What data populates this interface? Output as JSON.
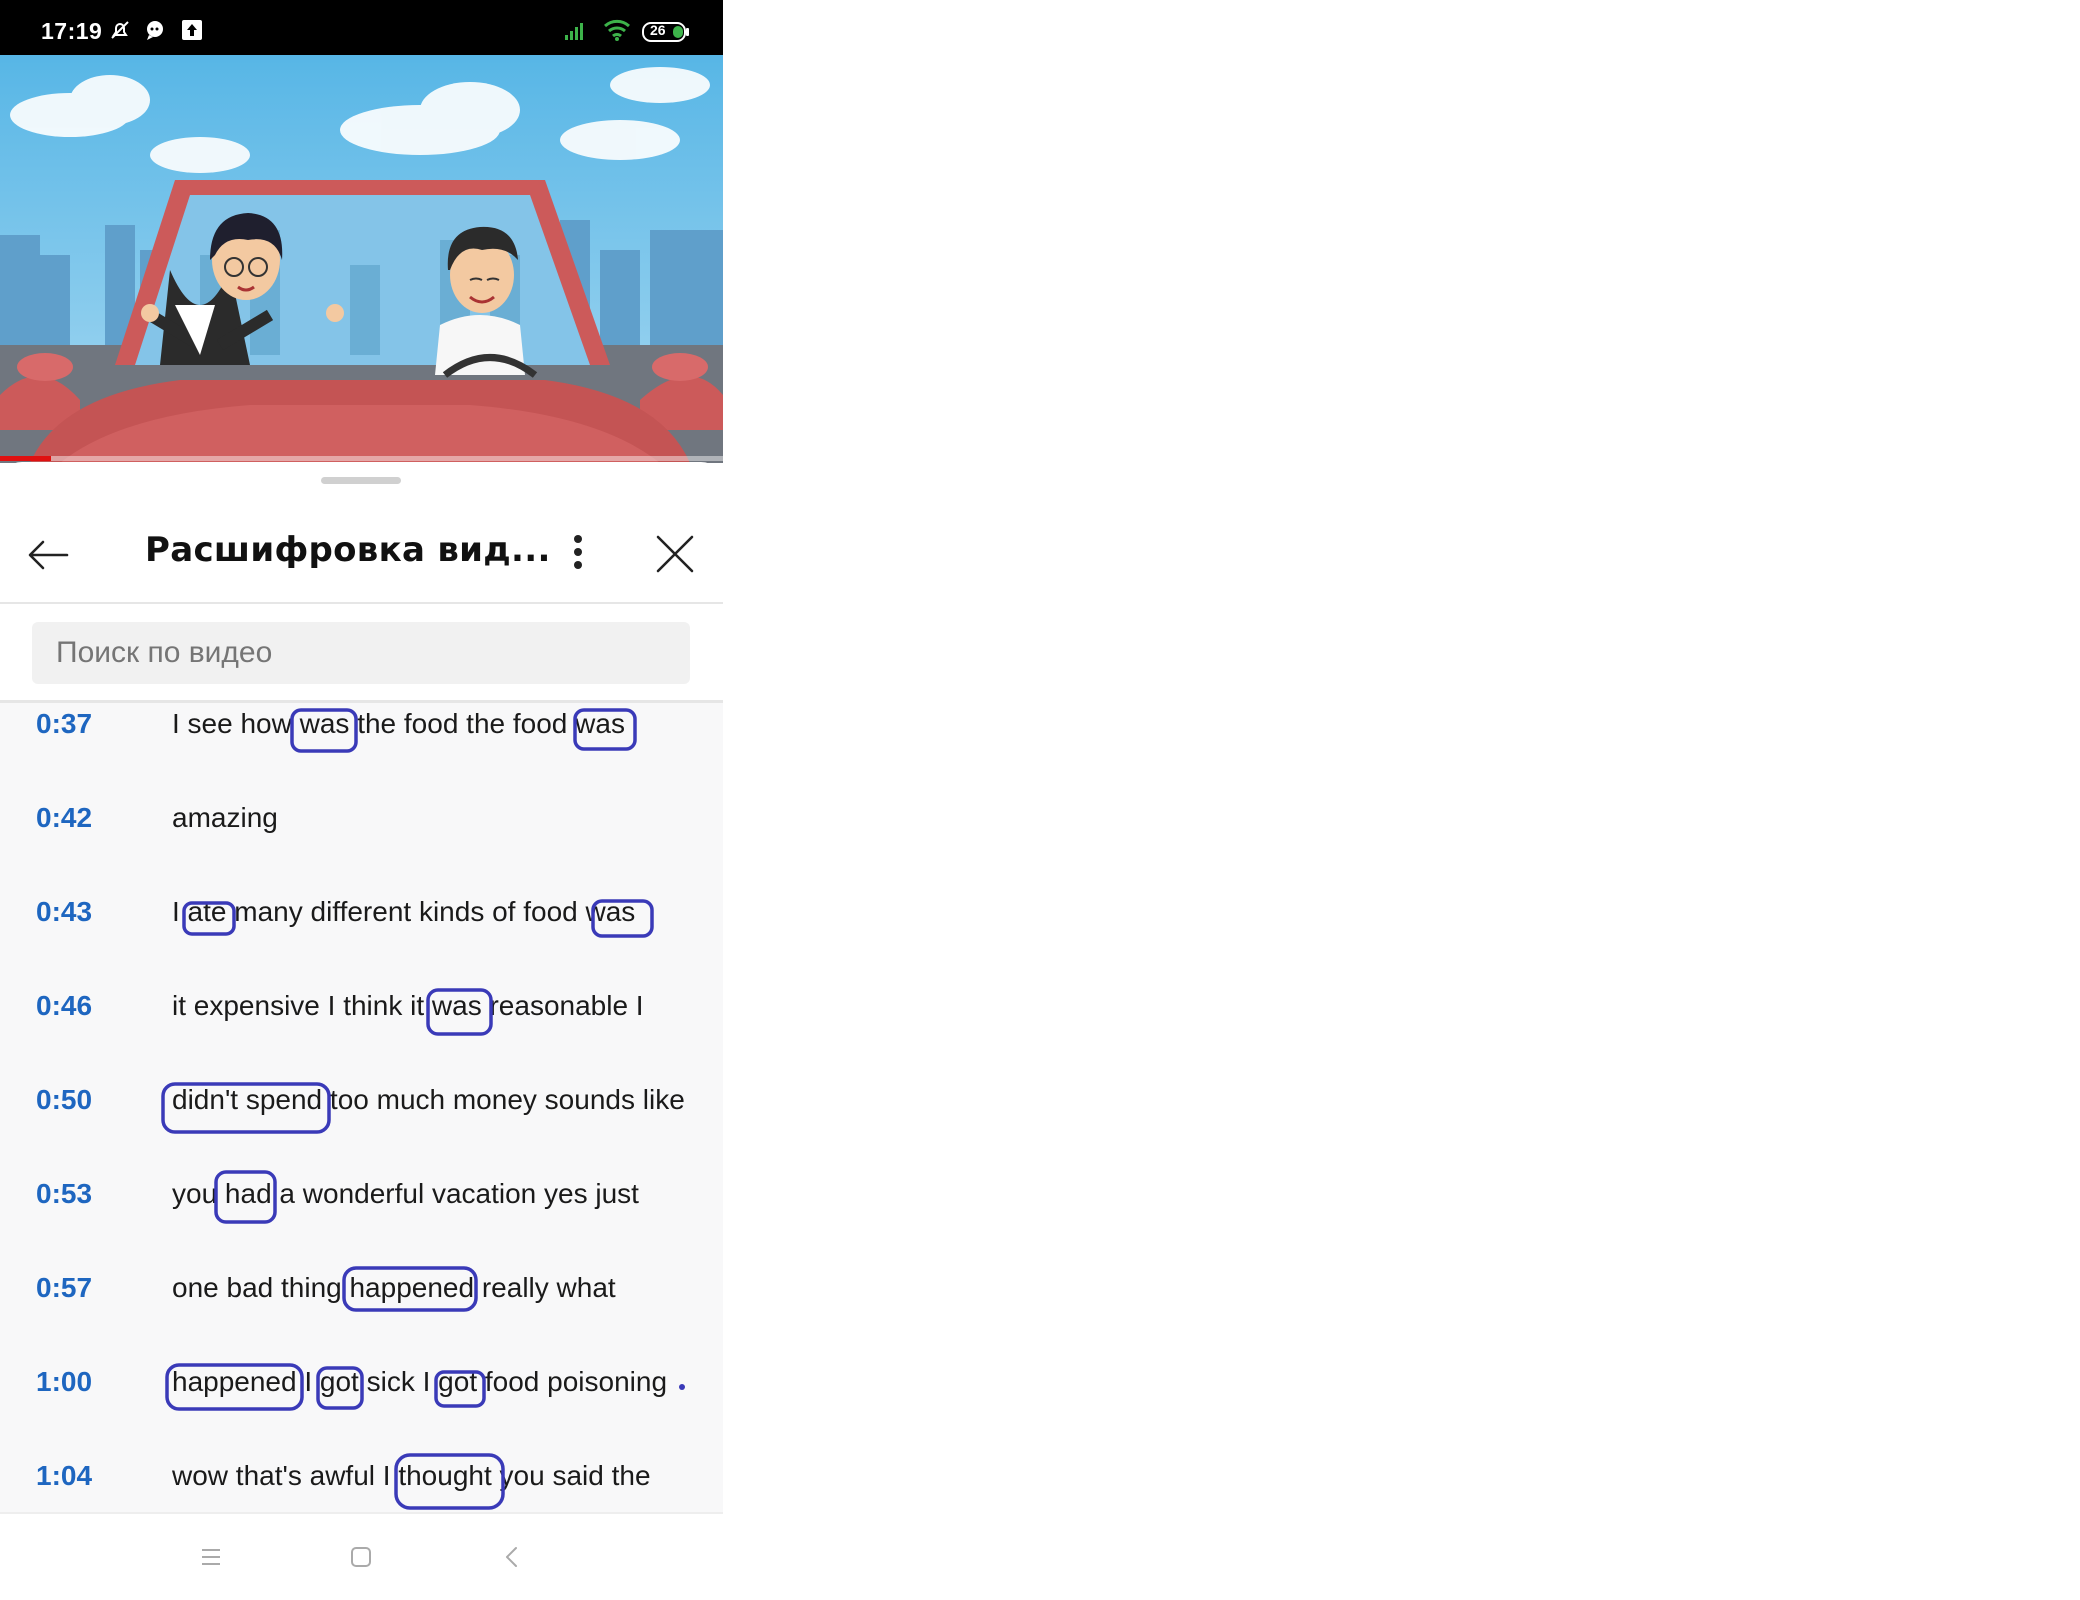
{
  "status_bar": {
    "time": "17:19",
    "battery": "26"
  },
  "panel": {
    "title": "Расшифровка вид...",
    "search_placeholder": "Поиск по видео"
  },
  "video": {
    "progress_fraction": 0.07
  },
  "transcript": [
    {
      "time": "0:37",
      "text": "I see how was the food the food was"
    },
    {
      "time": "0:42",
      "text": "amazing"
    },
    {
      "time": "0:43",
      "text": "I ate many different kinds of food was"
    },
    {
      "time": "0:46",
      "text": "it expensive I think it was reasonable I"
    },
    {
      "time": "0:50",
      "text": "didn't spend too much money sounds like"
    },
    {
      "time": "0:53",
      "text": "you had a wonderful vacation yes just"
    },
    {
      "time": "0:57",
      "text": "one bad thing happened really what"
    },
    {
      "time": "1:00",
      "text": "happened I got sick I got food poisoning"
    },
    {
      "time": "1:04",
      "text": "wow that's awful I thought you said the"
    }
  ],
  "colors": {
    "timestamp": "#1e66c0",
    "annotation": "#3a3ab8",
    "progress": "#e01010"
  },
  "icons": {
    "back": "arrow-left-icon",
    "more": "more-vertical-icon",
    "close": "close-icon",
    "nav_menu": "menu-icon",
    "nav_home": "home-square-icon",
    "nav_back": "chevron-left-icon"
  }
}
